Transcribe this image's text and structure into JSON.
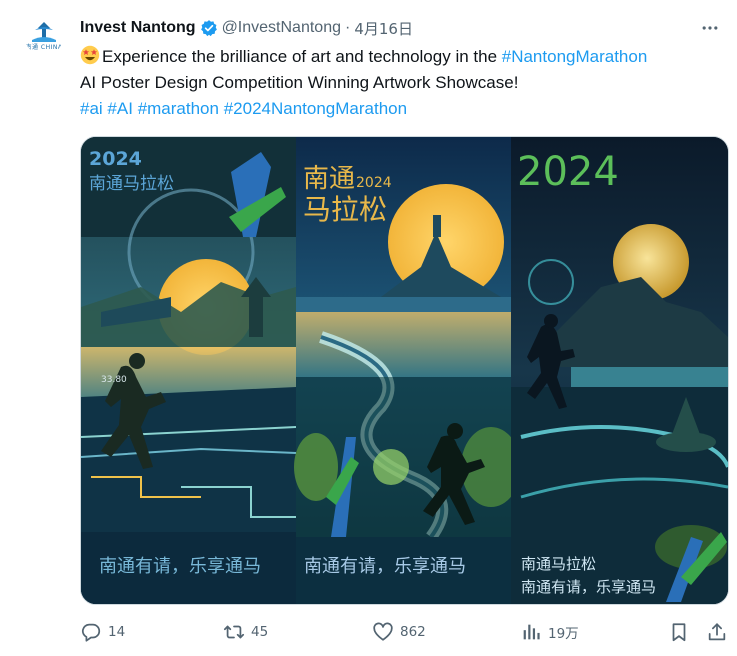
{
  "tweet": {
    "display_name": "Invest Nantong",
    "handle": "@InvestNantong",
    "separator": "·",
    "date": "4月16日",
    "avatar_caption": "南通 CHINA",
    "text_line1": "Experience the brilliance of art and technology in the ",
    "hashtag_inline": "#NantongMarathon",
    "text_line2": "AI Poster Design Competition Winning Artwork Showcase!",
    "hashtags": [
      "#ai",
      "#AI",
      "#marathon",
      "#2024NantongMarathon"
    ]
  },
  "media": {
    "panel1": {
      "year": "2024",
      "title": "南通马拉松",
      "small_text": "33.80",
      "slogan": "南通有请，乐享通马"
    },
    "panel2": {
      "title_top": "南通",
      "year": "2024",
      "title_bottom": "马拉松",
      "slogan": "南通有请，乐享通马"
    },
    "panel3": {
      "year": "2024",
      "title": "南通马拉松",
      "slogan": "南通有请，乐享通马"
    }
  },
  "actions": {
    "replies": "14",
    "retweets": "45",
    "likes": "862",
    "views": "19万"
  },
  "icons": {
    "verified": "verified-badge-icon",
    "more": "more-options-icon",
    "reply": "reply-icon",
    "retweet": "retweet-icon",
    "like": "heart-icon",
    "views": "views-chart-icon",
    "bookmark": "bookmark-icon",
    "share": "share-icon"
  },
  "colors": {
    "accent": "#1d9bf0",
    "text": "#0f1419",
    "secondary": "#536471"
  }
}
